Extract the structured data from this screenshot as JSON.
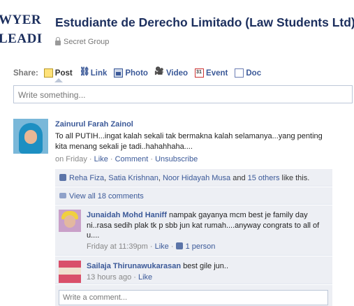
{
  "logo": {
    "line1": "WYER",
    "line2": "LEADI"
  },
  "group": {
    "title": "Estudiante de Derecho Limitado (Law Students Ltd)",
    "privacy": "Secret Group"
  },
  "share": {
    "label": "Share:",
    "items": [
      {
        "label": "Post",
        "icon": "post-icon",
        "active": true
      },
      {
        "label": "Link",
        "icon": "link-icon"
      },
      {
        "label": "Photo",
        "icon": "photo-icon"
      },
      {
        "label": "Video",
        "icon": "video-icon"
      },
      {
        "label": "Event",
        "icon": "event-icon"
      },
      {
        "label": "Doc",
        "icon": "doc-icon"
      }
    ],
    "composer_placeholder": "Write something..."
  },
  "post": {
    "author": "Zainurul Farah Zainol",
    "text": "To all PUTIH...ingat kalah sekali tak bermakna kalah selamanya...yang penting kita menang sekali je tadi..hahahhaha....",
    "time": "on Friday",
    "sep": " · ",
    "like": "Like",
    "comment": "Comment",
    "unsubscribe": "Unsubscribe",
    "likes": {
      "names": [
        "Reha Fiza",
        "Satia Krishnan",
        "Noor Hidayah Musa"
      ],
      "comma": ", ",
      "and": " and ",
      "others": "15 others",
      "suffix": " like this."
    },
    "view_all": "View all 18 comments"
  },
  "comments": [
    {
      "author": "Junaidah Mohd Haniff",
      "text": " nampak gayanya mcm best je family day ni..rasa sedih plak tk p sbb jun kat rumah....anyway congrats to all of u....",
      "time": "Friday at 11:39pm",
      "like": "Like",
      "like_count": "1 person"
    },
    {
      "author": "Sailaja Thirunawukarasan",
      "text": " best gile jun..",
      "time": "13 hours ago",
      "like": "Like"
    }
  ],
  "reply_placeholder": "Write a comment..."
}
